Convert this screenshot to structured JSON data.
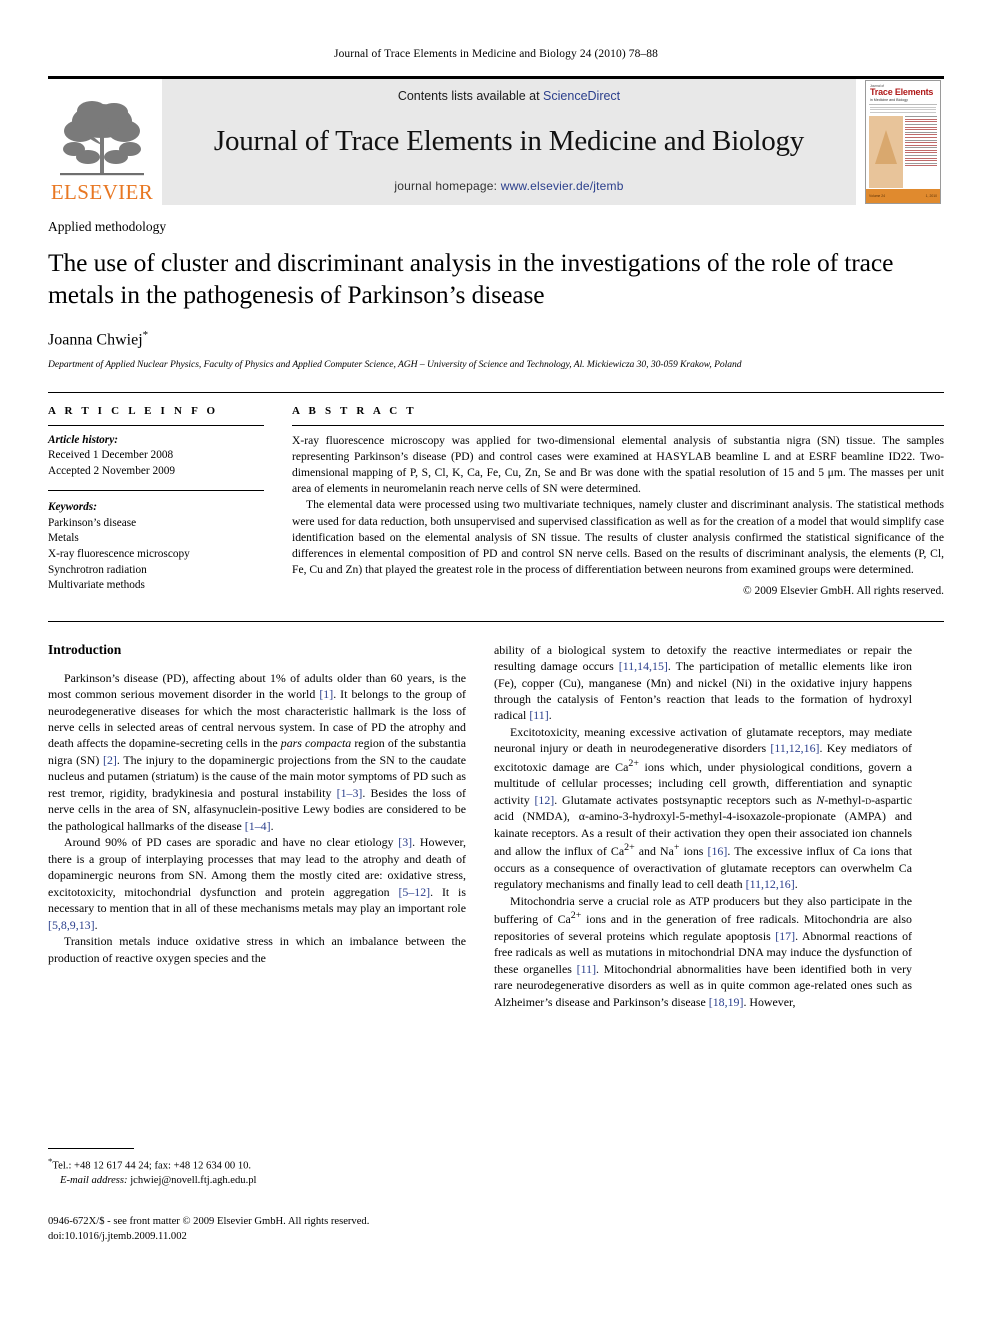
{
  "running_head": "Journal of Trace Elements in Medicine and Biology 24 (2010) 78–88",
  "masthead": {
    "publisher_wordmark": "ELSEVIER",
    "contents_line_prefix": "Contents lists available at ",
    "contents_link": "ScienceDirect",
    "journal_title": "Journal of Trace Elements in Medicine and Biology",
    "homepage_prefix": "journal homepage: ",
    "homepage_link": "www.elsevier.de/jtemb",
    "cover": {
      "kicker": "Journal of",
      "title": "Trace Elements",
      "subtitle": "in Medicine and Biology",
      "volume_left": "Volume 24",
      "volume_right": "1, 2010"
    },
    "link_color": "#2b3f8c",
    "brand_color": "#E87722",
    "banner_bg": "#e8e8e8"
  },
  "article": {
    "section_type": "Applied methodology",
    "title": "The use of cluster and discriminant analysis in the investigations of the role of trace metals in the pathogenesis of Parkinson’s disease",
    "author": "Joanna Chwiej",
    "author_marker": "*",
    "affiliation": "Department of Applied Nuclear Physics, Faculty of Physics and Applied Computer Science, AGH – University of Science and Technology, Al. Mickiewicza 30, 30-059 Krakow, Poland"
  },
  "article_info": {
    "label": "A R T I C L E  I N F O",
    "history_label": "Article history:",
    "received": "Received 1 December 2008",
    "accepted": "Accepted 2 November 2009",
    "keywords_label": "Keywords:",
    "keywords": [
      "Parkinson’s disease",
      "Metals",
      "X-ray fluorescence microscopy",
      "Synchrotron radiation",
      "Multivariate methods"
    ]
  },
  "abstract": {
    "label": "A B S T R A C T",
    "paragraphs": [
      "X-ray fluorescence microscopy was applied for two-dimensional elemental analysis of substantia nigra (SN) tissue. The samples representing Parkinson’s disease (PD) and control cases were examined at HASYLAB beamline L and at ESRF beamline ID22. Two-dimensional mapping of P, S, Cl, K, Ca, Fe, Cu, Zn, Se and Br was done with the spatial resolution of 15 and 5 μm. The masses per unit area of elements in neuromelanin reach nerve cells of SN were determined.",
      "The elemental data were processed using two multivariate techniques, namely cluster and discriminant analysis. The statistical methods were used for data reduction, both unsupervised and supervised classification as well as for the creation of a model that would simplify case identification based on the elemental analysis of SN tissue. The results of cluster analysis confirmed the statistical significance of the differences in elemental composition of PD and control SN nerve cells. Based on the results of discriminant analysis, the elements (P, Cl, Fe, Cu and Zn) that played the greatest role in the process of differentiation between neurons from examined groups were determined."
    ],
    "copyright": "© 2009 Elsevier GmbH. All rights reserved."
  },
  "body": {
    "intro_heading": "Introduction",
    "left_paragraphs": [
      "Parkinson’s disease (PD), affecting about 1% of adults older than 60 years, is the most common serious movement disorder in the world [1]. It belongs to the group of neurodegenerative diseases for which the most characteristic hallmark is the loss of nerve cells in selected areas of central nervous system. In case of PD the atrophy and death affects the dopamine-secreting cells in the pars compacta region of the substantia nigra (SN) [2]. The injury to the dopaminergic projections from the SN to the caudate nucleus and putamen (striatum) is the cause of the main motor symptoms of PD such as rest tremor, rigidity, bradykinesia and postural instability [1–3]. Besides the loss of nerve cells in the area of SN, alfasynuclein-positive Lewy bodies are considered to be the pathological hallmarks of the disease [1–4].",
      "Around 90% of PD cases are sporadic and have no clear etiology [3]. However, there is a group of interplaying processes that may lead to the atrophy and death of dopaminergic neurons from SN. Among them the mostly cited are: oxidative stress, excitotoxicity, mitochondrial dysfunction and protein aggregation [5–12]. It is necessary to mention that in all of these mechanisms metals may play an important role [5,8,9,13].",
      "Transition metals induce oxidative stress in which an imbalance between the production of reactive oxygen species and the"
    ],
    "right_paragraphs": [
      "ability of a biological system to detoxify the reactive intermediates or repair the resulting damage occurs [11,14,15]. The participation of metallic elements like iron (Fe), copper (Cu), manganese (Mn) and nickel (Ni) in the oxidative injury happens through the catalysis of Fenton’s reaction that leads to the formation of hydroxyl radical [11].",
      "Excitotoxicity, meaning excessive activation of glutamate receptors, may mediate neuronal injury or death in neurodegenerative disorders [11,12,16]. Key mediators of excitotoxic damage are Ca2+ ions which, under physiological conditions, govern a multitude of cellular processes; including cell growth, differentiation and synaptic activity [12]. Glutamate activates postsynaptic receptors such as N-methyl-D-aspartic acid (NMDA), α-amino-3-hydroxyl-5-methyl-4-isoxazole-propionate (AMPA) and kainate receptors. As a result of their activation they open their associated ion channels and allow the influx of Ca2+ and Na+ ions [16]. The excessive influx of Ca ions that occurs as a consequence of overactivation of glutamate receptors can overwhelm Ca regulatory mechanisms and finally lead to cell death [11,12,16].",
      "Mitochondria serve a crucial role as ATP producers but they also participate in the buffering of Ca2+ ions and in the generation of free radicals. Mitochondria are also repositories of several proteins which regulate apoptosis [17]. Abnormal reactions of free radicals as well as mutations in mitochondrial DNA may induce the dysfunction of these organelles [11]. Mitochondrial abnormalities have been identified both in very rare neurodegenerative disorders as well as in quite common age-related ones such as Alzheimer’s disease and Parkinson’s disease [18,19]. However,"
    ]
  },
  "footnote": {
    "marker": "*",
    "tel_fax": "Tel.: +48 12 617 44 24; fax: +48 12 634 00 10.",
    "email_label": "E-mail address:",
    "email": "jchwiej@novell.ftj.agh.edu.pl"
  },
  "footer": {
    "front_matter": "0946-672X/$ - see front matter © 2009 Elsevier GmbH. All rights reserved.",
    "doi": "doi:10.1016/j.jtemb.2009.11.002"
  }
}
